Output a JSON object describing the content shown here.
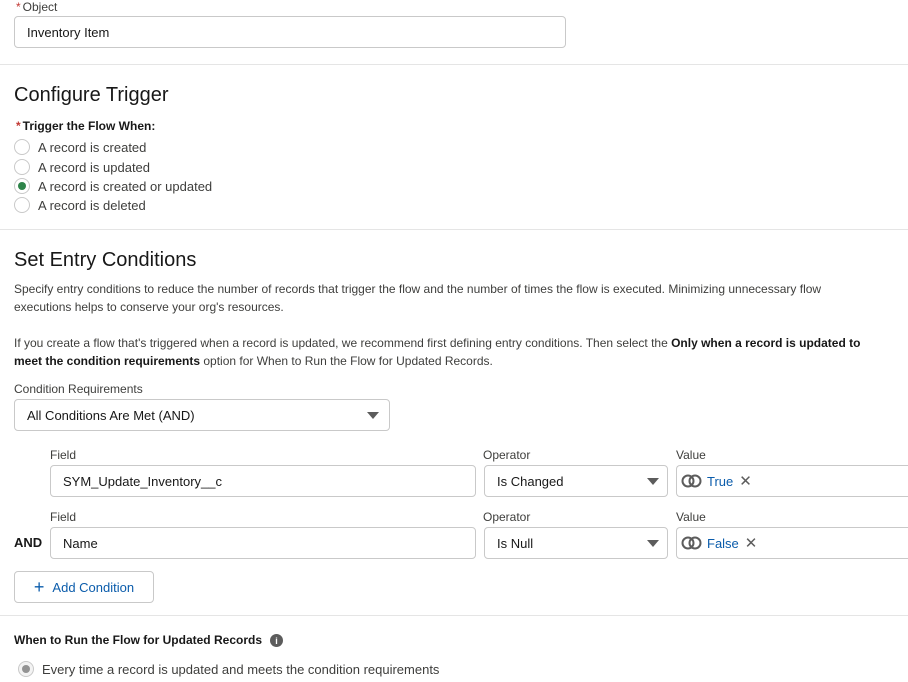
{
  "object": {
    "label": "Object",
    "required_mark": "*",
    "value": "Inventory Item"
  },
  "configure_trigger": {
    "title": "Configure Trigger",
    "label": "Trigger the Flow When:",
    "required_mark": "*",
    "options": [
      {
        "label": "A record is created",
        "checked": false
      },
      {
        "label": "A record is updated",
        "checked": false
      },
      {
        "label": "A record is created or updated",
        "checked": true
      },
      {
        "label": "A record is deleted",
        "checked": false
      }
    ]
  },
  "entry_conditions": {
    "title": "Set Entry Conditions",
    "desc1": "Specify entry conditions to reduce the number of records that trigger the flow and the number of times the flow is executed. Minimizing unnecessary flow executions helps to conserve your org's resources.",
    "desc2_pre": "If you create a flow that's triggered when a record is updated, we recommend first defining entry conditions. Then select the ",
    "desc2_bold": "Only when a record is updated to meet the condition requirements",
    "desc2_post": " option for When to Run the Flow for Updated Records.",
    "condition_req_label": "Condition Requirements",
    "condition_req_value": "All Conditions Are Met (AND)",
    "conditions": [
      {
        "prefix": "",
        "field_label": "Field",
        "field_value": "SYM_Update_Inventory__c",
        "operator_label": "Operator",
        "operator_value": "Is Changed",
        "value_label": "Value",
        "value": "True"
      },
      {
        "prefix": "AND",
        "field_label": "Field",
        "field_value": "Name",
        "operator_label": "Operator",
        "operator_value": "Is Null",
        "value_label": "Value",
        "value": "False"
      }
    ],
    "add_condition_label": "Add Condition"
  },
  "when_to_run": {
    "label": "When to Run the Flow for Updated Records",
    "options": [
      {
        "label": "Every time a record is updated and meets the condition requirements",
        "checked": true
      }
    ]
  },
  "colors": {
    "accent_green": "#2e844a",
    "link_blue": "#0b5cab",
    "required_red": "#c23934",
    "border": "#c9c9c9"
  }
}
